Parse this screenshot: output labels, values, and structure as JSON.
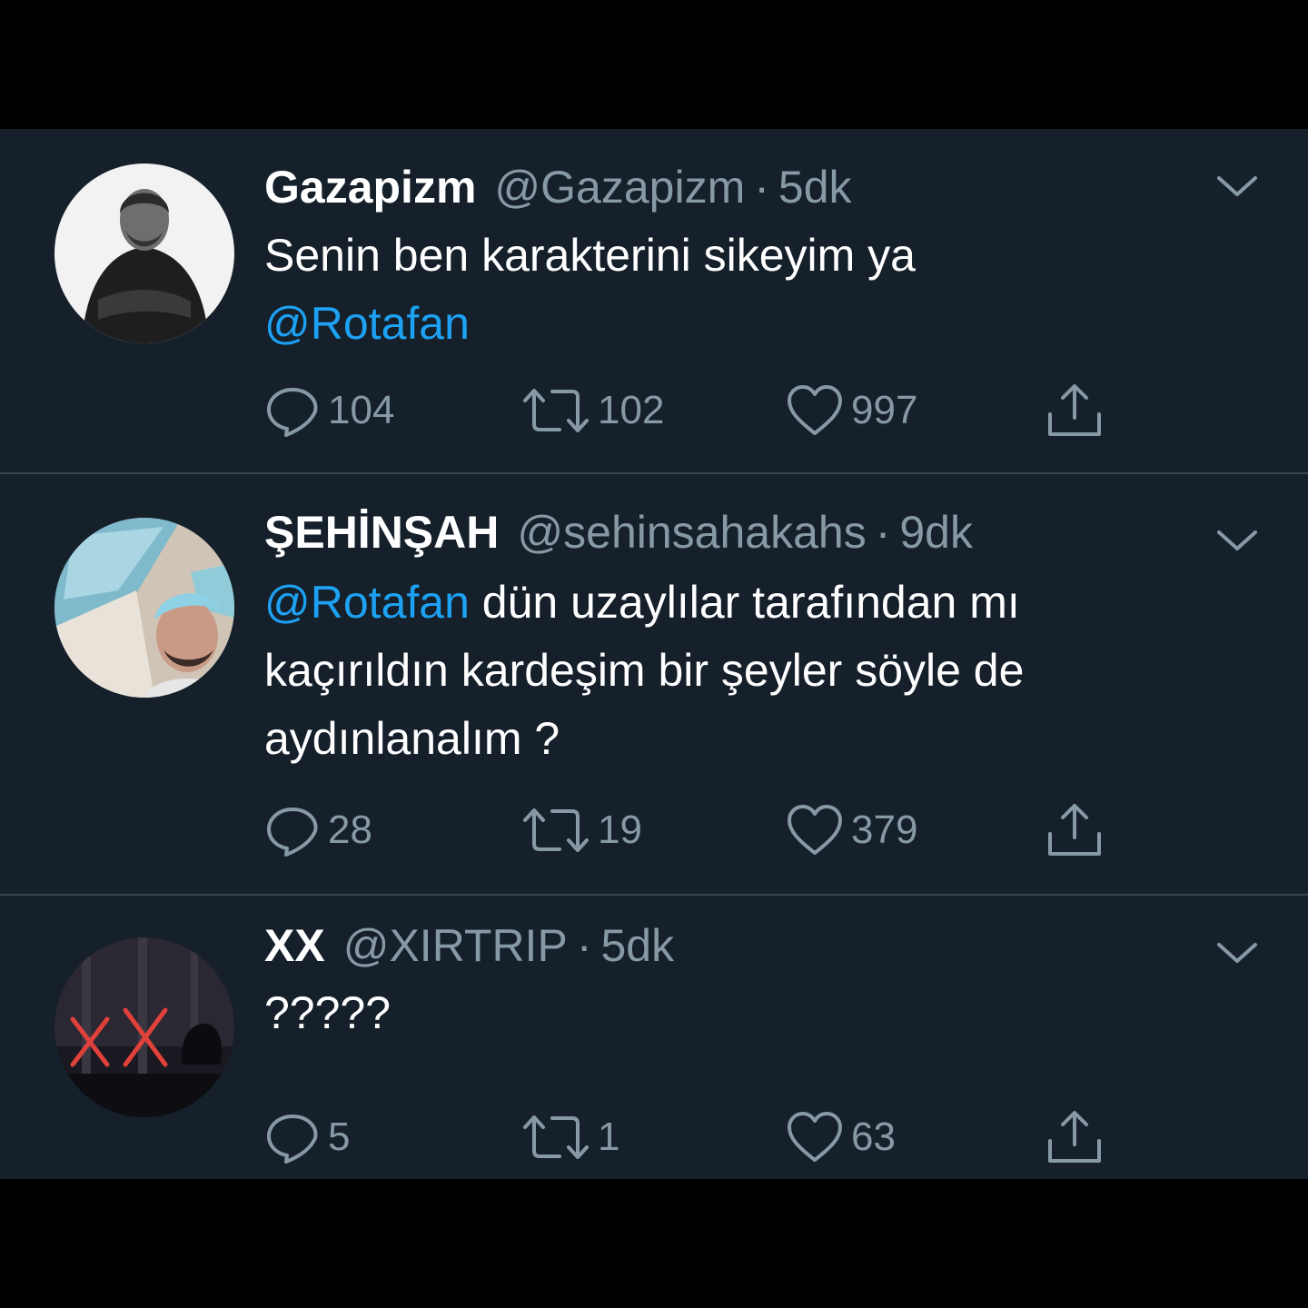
{
  "tweets": [
    {
      "name": "Gazapizm",
      "handle": "@Gazapizm",
      "separator": "·",
      "time": "5dk",
      "text_line_1": "Senin ben karakterini sikeyim ya",
      "mention": "@Rotafan",
      "replies": "104",
      "retweets": "102",
      "likes": "997"
    },
    {
      "name": "ŞEHİNŞAH",
      "handle": "@sehinsahakahs",
      "separator": "·",
      "time": "9dk",
      "mention": "@Rotafan",
      "text_after_mention": " dün uzaylılar tarafından mı",
      "text_line_2": "kaçırıldın kardeşim bir şeyler söyle de",
      "text_line_3": "aydınlanalım ?",
      "replies": "28",
      "retweets": "19",
      "likes": "379"
    },
    {
      "name": "XX",
      "handle": "@XIRTRIP",
      "separator": "·",
      "time": "5dk",
      "text": "?????",
      "replies": "5",
      "retweets": "1",
      "likes": "63"
    }
  ],
  "icons": {
    "reply": "reply-icon",
    "retweet": "retweet-icon",
    "like": "heart-icon",
    "share": "share-icon",
    "menu": "chevron-down-icon"
  },
  "colors": {
    "background": "#15202b",
    "frame": "#000000",
    "divider": "#38444d",
    "secondary_text": "#8899a6",
    "mention": "#1da1f2",
    "primary_text": "#ffffff"
  }
}
